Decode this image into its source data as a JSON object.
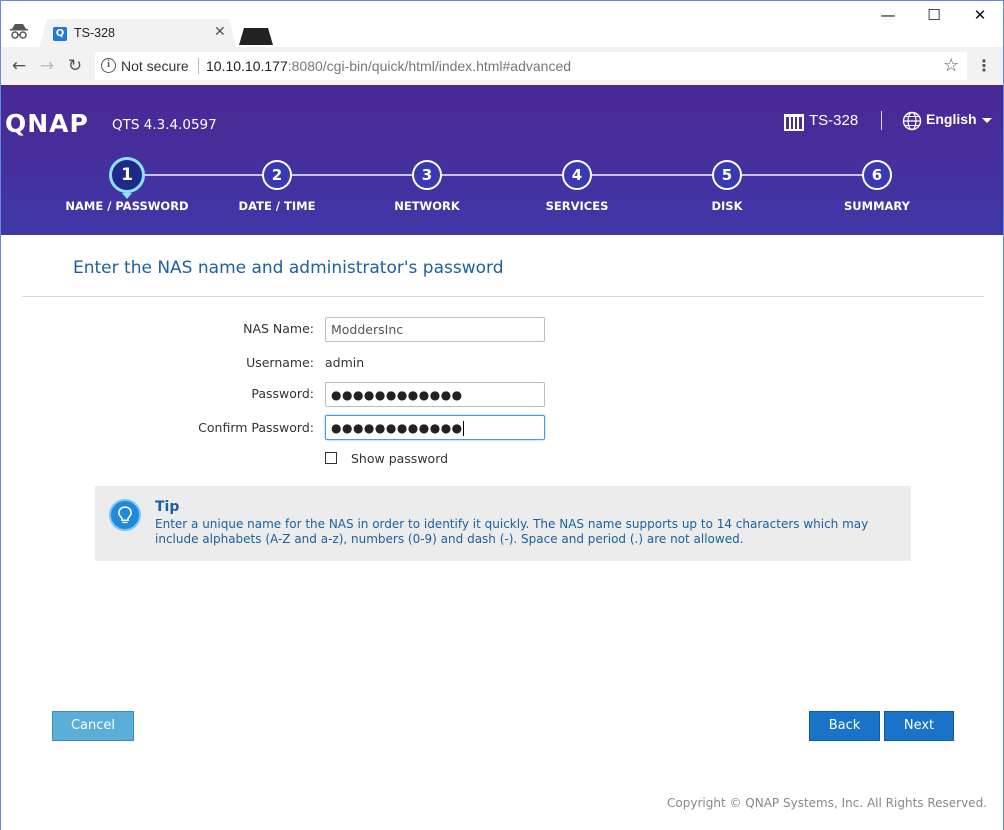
{
  "browser": {
    "tab_title": "TS-328",
    "tab_favicon_letter": "Q",
    "security_label": "Not secure",
    "url_host": "10.10.10.177",
    "url_rest": ":8080/cgi-bin/quick/html/index.html#advanced"
  },
  "header": {
    "logo": "QNAP",
    "version": "QTS 4.3.4.0597",
    "device_name": "TS-328",
    "language": "English"
  },
  "steps": [
    {
      "number": "1",
      "label": "NAME / PASSWORD",
      "active": true
    },
    {
      "number": "2",
      "label": "DATE / TIME",
      "active": false
    },
    {
      "number": "3",
      "label": "NETWORK",
      "active": false
    },
    {
      "number": "4",
      "label": "SERVICES",
      "active": false
    },
    {
      "number": "5",
      "label": "DISK",
      "active": false
    },
    {
      "number": "6",
      "label": "SUMMARY",
      "active": false
    }
  ],
  "form": {
    "title": "Enter the NAS name and administrator's password",
    "nas_name_label": "NAS Name:",
    "nas_name_value": "ModdersInc",
    "username_label": "Username:",
    "username_value": "admin",
    "password_label": "Password:",
    "password_masked": "●●●●●●●●●●●●",
    "confirm_label": "Confirm Password:",
    "confirm_masked": "●●●●●●●●●●●●",
    "show_password_label": "Show password",
    "show_password_checked": false
  },
  "tip": {
    "title": "Tip",
    "text": "Enter a unique name for the NAS in order to identify it quickly. The NAS name supports up to 14 characters which may include alphabets (A-Z and a-z), numbers (0-9) and dash (-). Space and period (.) are not allowed."
  },
  "buttons": {
    "cancel": "Cancel",
    "back": "Back",
    "next": "Next"
  },
  "footer": {
    "copyright": "Copyright © QNAP Systems, Inc. All Rights Reserved."
  },
  "colors": {
    "accent": "#1a73c8",
    "title_blue": "#1d5fa1",
    "header_gradient_top": "#4a2894"
  }
}
